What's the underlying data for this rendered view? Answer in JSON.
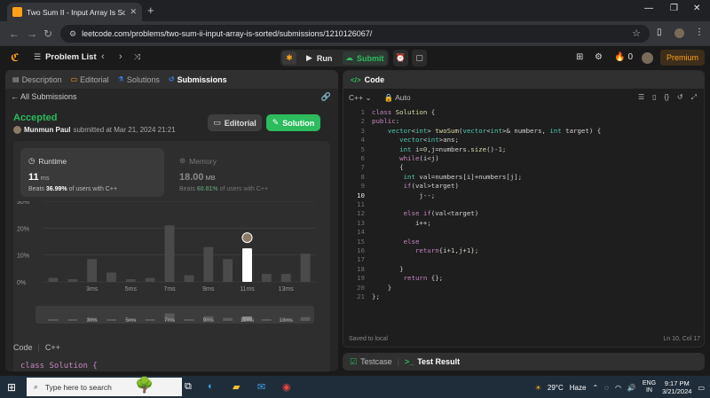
{
  "browser": {
    "tab_title": "Two Sum II - Input Array Is Sort",
    "url": "leetcode.com/problems/two-sum-ii-input-array-is-sorted/submissions/1210126067/"
  },
  "nav": {
    "problem_list": "Problem List",
    "run": "Run",
    "submit": "Submit",
    "streak": "0",
    "premium": "Premium"
  },
  "left_tabs": [
    "Description",
    "Editorial",
    "Solutions",
    "Submissions"
  ],
  "submission": {
    "back": "All Submissions",
    "status": "Accepted",
    "user": "Munmun Paul",
    "submitted": "submitted at Mar 21, 2024 21:21",
    "editorial_btn": "Editorial",
    "solution_btn": "Solution",
    "runtime_label": "Runtime",
    "runtime_value": "11",
    "runtime_unit": "ms",
    "runtime_beats_pre": "Beats",
    "runtime_beats": "36.99%",
    "runtime_beats_post": "of users with C++",
    "memory_label": "Memory",
    "memory_value": "18.00",
    "memory_unit": "MB",
    "memory_beats_pre": "Beats",
    "memory_beats": "60.81%",
    "memory_beats_post": "of users with C++"
  },
  "chart_data": {
    "type": "bar",
    "yticks": [
      "30%",
      "20%",
      "10%",
      "0%"
    ],
    "ylim": [
      0,
      30
    ],
    "xticks": [
      "3ms",
      "5ms",
      "7ms",
      "9ms",
      "11ms",
      "13ms"
    ],
    "values": [
      1.5,
      1,
      8.5,
      3.5,
      1,
      1.5,
      21,
      2.5,
      13,
      8.5,
      12.5,
      3,
      3,
      10.5
    ],
    "highlight_index": 10
  },
  "code_header": {
    "label": "Code",
    "lang": "C++"
  },
  "code_preview": "class Solution {",
  "editor": {
    "tab": "Code",
    "lang": "C++",
    "mode": "Auto",
    "status_left": "Saved to local",
    "status_right": "Ln 10, Col 17",
    "current_line": 10,
    "lines": [
      "class Solution {",
      "public:",
      "    vector<int> twoSum(vector<int>& numbers, int target) {",
      "       vector<int>ans;",
      "       int i=0,j=numbers.size()-1;",
      "       while(i<j)",
      "       {",
      "        int val=numbers[i]+numbers[j];",
      "        if(val>target)",
      "            j--;",
      "",
      "        else if(val<target)",
      "           i++;",
      "",
      "        else",
      "           return{i+1,j+1};",
      "",
      "       }",
      "        return {};",
      "    }",
      "};"
    ]
  },
  "testbar": {
    "testcase": "Testcase",
    "result": "Test Result"
  },
  "taskbar": {
    "search": "Type here to search",
    "temp": "29°C",
    "weather": "Haze",
    "lang1": "ENG",
    "lang2": "IN",
    "time": "9:17 PM",
    "date": "3/21/2024"
  }
}
